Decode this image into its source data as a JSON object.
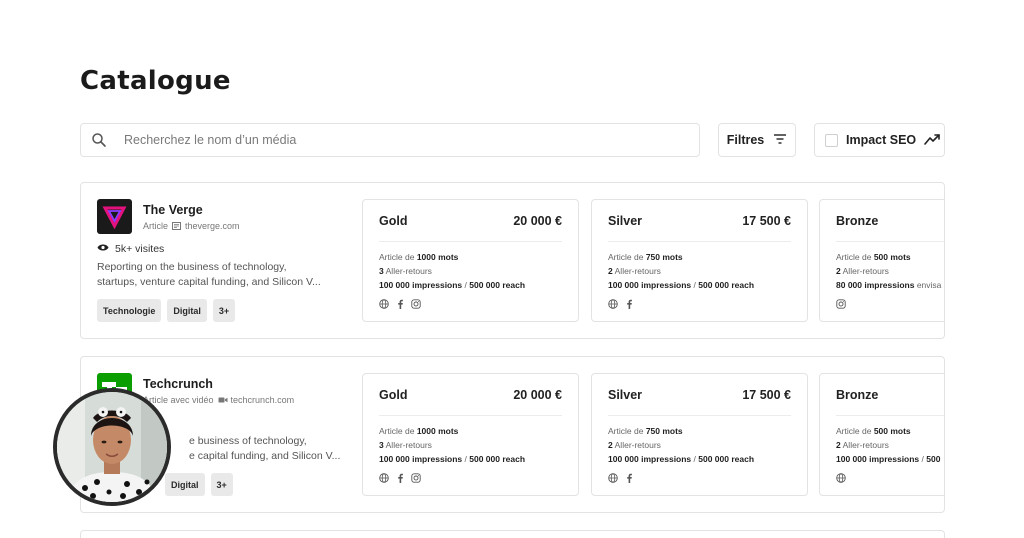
{
  "page": {
    "title": "Catalogue"
  },
  "search": {
    "placeholder": "Recherchez le nom d’un média"
  },
  "toolbar": {
    "filters_label": "Filtres",
    "seo_label": "Impact SEO"
  },
  "media": [
    {
      "name": "The Verge",
      "type": "Article",
      "domain": "theverge.com",
      "visits": "5k+ visites",
      "description": [
        "Reporting on the business of technology,",
        "startups, venture capital funding, and Silicon V..."
      ],
      "tags": [
        "Technologie",
        "Digital",
        "3+"
      ],
      "offers": [
        {
          "tier": "Gold",
          "price": "20 000 €",
          "words": "1000 mots",
          "round_trips": "3",
          "impressions": "100 000 impressions",
          "reach": "500 000 reach",
          "socials": [
            "globe-icon",
            "facebook-icon",
            "instagram-icon"
          ]
        },
        {
          "tier": "Silver",
          "price": "17 500 €",
          "words": "750 mots",
          "round_trips": "2",
          "impressions": "100 000 impressions",
          "reach": "500 000 reach",
          "socials": [
            "globe-icon",
            "facebook-icon"
          ]
        },
        {
          "tier": "Bronze",
          "price": "",
          "words": "500 mots",
          "round_trips": "2",
          "impressions": "80 000 impressions",
          "extra": "envisa",
          "socials": [
            "instagram-icon"
          ]
        }
      ]
    },
    {
      "name": "Techcrunch",
      "type": "Article avec vidéo",
      "domain": "techcrunch.com",
      "description": [
        "e business of technology,",
        "e capital funding, and Silicon V..."
      ],
      "tags": [
        "Digital",
        "3+"
      ],
      "offers": [
        {
          "tier": "Gold",
          "price": "20 000 €",
          "words": "1000 mots",
          "round_trips": "3",
          "impressions": "100 000 impressions",
          "reach": "500 000 reach",
          "socials": [
            "globe-icon",
            "facebook-icon",
            "instagram-icon"
          ]
        },
        {
          "tier": "Silver",
          "price": "17 500 €",
          "words": "750 mots",
          "round_trips": "2",
          "impressions": "100 000 impressions",
          "reach": "500 000 reach",
          "socials": [
            "globe-icon",
            "facebook-icon"
          ]
        },
        {
          "tier": "Bronze",
          "price": "",
          "words": "500 mots",
          "round_trips": "2",
          "impressions": "100 000 impressions",
          "reach": "500",
          "socials": [
            "globe-icon"
          ]
        }
      ]
    }
  ],
  "labels": {
    "article_de": "Article de",
    "aller_retours": "Aller-retours"
  },
  "colors": {
    "verge_logo_bg": "#1a1a1a",
    "verge_logo_accent": "#e5127d",
    "techcrunch_green": "#0a9e01",
    "border": "#e3e3e3",
    "tag_bg": "#e9e9e9"
  }
}
